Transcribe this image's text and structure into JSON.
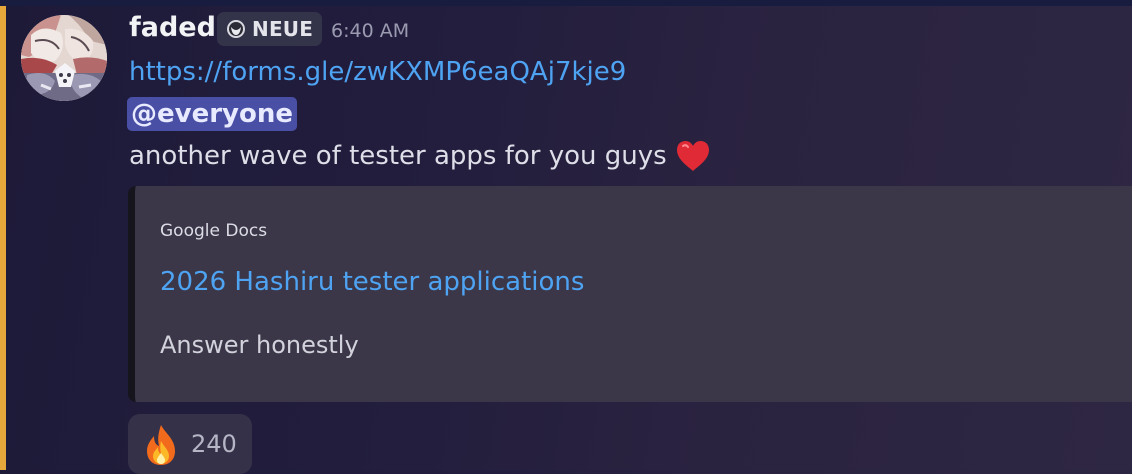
{
  "message": {
    "author": "faded",
    "guild_tag": "NEUE",
    "guild_tag_icon": "moon-badge-icon",
    "timestamp": "6:40 AM",
    "link": "https://forms.gle/zwKXMP6eaQAj7kje9",
    "mention": "@everyone",
    "text": "another wave of tester apps for you guys",
    "text_emoji": "heart-icon"
  },
  "embed": {
    "provider": "Google Docs",
    "title": "2026 Hashiru tester applications",
    "description": "Answer honestly"
  },
  "reaction": {
    "emoji": "fire-icon",
    "count": "240"
  },
  "colors": {
    "mention_bar": "#e6a83a",
    "link": "#4ea3f2",
    "mention_bg": "#4a4fa6",
    "embed_bg": "#3b3749"
  }
}
